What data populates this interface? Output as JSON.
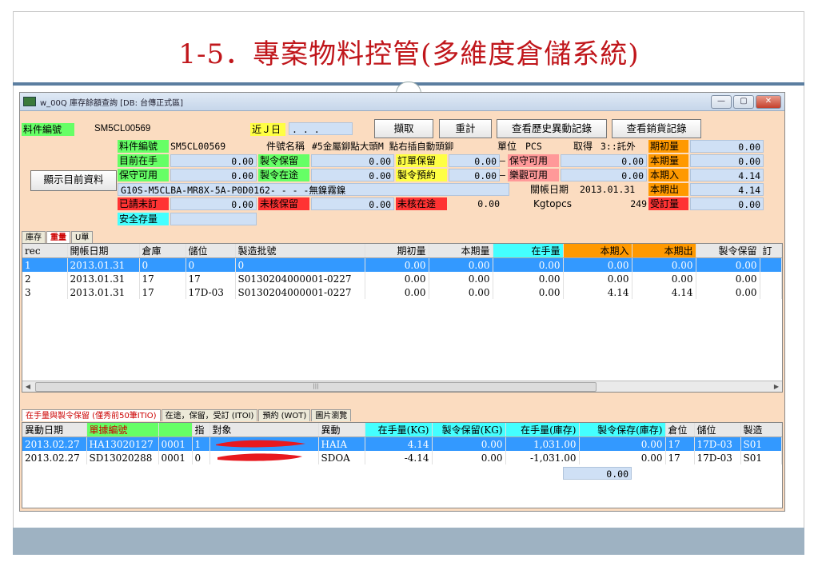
{
  "slide": {
    "title": "1-5．專案物料控管(多維度倉儲系統)"
  },
  "window": {
    "title": "w_00Q 庫存餘額查詢 [DB: 台傳正式區]",
    "controls": {
      "minimize": "—",
      "maximize": "▢",
      "close": "✕"
    }
  },
  "query": {
    "part_no_label": "料件編號",
    "part_no_value": "SM5CL00569",
    "recent_label": "近Ｊ日",
    "recent_value": ". . .",
    "fetch_btn": "擷取",
    "recalc_btn": "重計",
    "history_btn": "查看歷史異動記錄",
    "sales_btn": "查看銷貨記錄",
    "show_current_btn": "顯示目前資料"
  },
  "info": {
    "part_no_label": "料件編號",
    "part_no_value": "SM5CL00569",
    "name_label": "件號名稱",
    "name_value": "#5金屬鉚點大頭M 點右插自動頭鉚",
    "unit_label": "單位",
    "unit_value": "PCS",
    "acquire_label": "取得",
    "acquire_value": "3::託外",
    "on_hand_label": "目前在手",
    "on_hand_value": "0.00",
    "wo_reserve_label": "製令保留",
    "wo_reserve_value": "0.00",
    "order_reserve_label": "訂單保留",
    "order_reserve_value": "0.00",
    "safe_avail_label": "保守可用",
    "safe_avail_value": "0.00",
    "wo_transit_label": "製令在途",
    "wo_transit_value": "0.00",
    "wo_booked_label": "製令預約",
    "wo_booked_value": "0.00",
    "safe_avail2_label": "保守可用",
    "safe_avail2_value": "0.00",
    "optimistic_label": "樂觀可用",
    "optimistic_value": "0.00",
    "spec_value": "G10S-M5CLBA-MR8X-5A-P0D0162- - - -無鎳霧鎳",
    "close_date_label": "關帳日期",
    "close_date_value": "2013.01.31",
    "requested_label": "已請未訂",
    "requested_value": "0.00",
    "unverified_reserve_label": "未核保留",
    "unverified_reserve_value": "0.00",
    "unverified_transit_label": "未核在途",
    "unverified_transit_value": "0.00",
    "kgtopcs_label": "Kgtopcs",
    "kgtopcs_value": "249",
    "safety_stock_label": "安全存量",
    "period_init_label": "期初量",
    "period_init_value": "0.00",
    "period_qty_label": "本期量",
    "period_qty_value": "0.00",
    "period_in_label": "本期入",
    "period_in_value": "4.14",
    "period_out_label": "本期出",
    "period_out_value": "4.14",
    "ordered_label": "受訂量",
    "ordered_value": "0.00",
    "dash1": "—",
    "dash2": "—"
  },
  "upper_tabs": [
    {
      "label": "庫存",
      "active": false
    },
    {
      "label": "重量",
      "active": true
    },
    {
      "label": "U單",
      "active": false
    }
  ],
  "stock_table": {
    "headers": [
      "rec",
      "開帳日期",
      "倉庫",
      "儲位",
      "製造批號",
      "期初量",
      "本期量",
      "在手量",
      "本期入",
      "本期出",
      "製令保留",
      "訂"
    ],
    "rows": [
      [
        "1",
        "2013.01.31",
        "0",
        "0",
        "0",
        "0.00",
        "0.00",
        "0.00",
        "0.00",
        "0.00",
        "0.00",
        ""
      ],
      [
        "2",
        "2013.01.31",
        "17",
        "17",
        "S0130204000001-0227",
        "0.00",
        "0.00",
        "0.00",
        "0.00",
        "0.00",
        "0.00",
        ""
      ],
      [
        "3",
        "2013.01.31",
        "17",
        "17D-03",
        "S0130204000001-0227",
        "0.00",
        "0.00",
        "0.00",
        "4.14",
        "4.14",
        "0.00",
        ""
      ]
    ],
    "scroll_left": "◀",
    "scroll_right": "▶",
    "scroll_thumb": "|||"
  },
  "lower_tabs": [
    {
      "label": "在手量與製令保留 (僅秀前50筆ITIO)",
      "active": true
    },
    {
      "label": "在途，保留，受訂 (ITOI)",
      "active": false
    },
    {
      "label": "預約 (WOT)",
      "active": false
    },
    {
      "label": "圖片瀏覽",
      "active": false
    }
  ],
  "tx_table": {
    "headers": [
      "異動日期",
      "單據編號",
      "",
      "指",
      "對象",
      "異動",
      "在手量(KG)",
      "製令保留(KG)",
      "在手量(庫存)",
      "製令保存(庫存)",
      "倉位",
      "儲位",
      "製造"
    ],
    "rows": [
      [
        "2013.02.27",
        "HA13020127",
        "0001",
        "1",
        "",
        "HAIA",
        "4.14",
        "0.00",
        "1,031.00",
        "0.00",
        "17",
        "17D-03",
        "S01"
      ],
      [
        "2013.02.27",
        "SD13020288",
        "0001",
        "0",
        "",
        "SDOA",
        "-4.14",
        "0.00",
        "-1,031.00",
        "0.00",
        "17",
        "17D-03",
        "S01"
      ]
    ],
    "total": "0.00"
  },
  "colors": {
    "title": "#c0161b",
    "window_bg": "#fbdcc0",
    "field": "#cfe0f5",
    "selection": "#3399ff",
    "redaction": "#e8191f"
  }
}
